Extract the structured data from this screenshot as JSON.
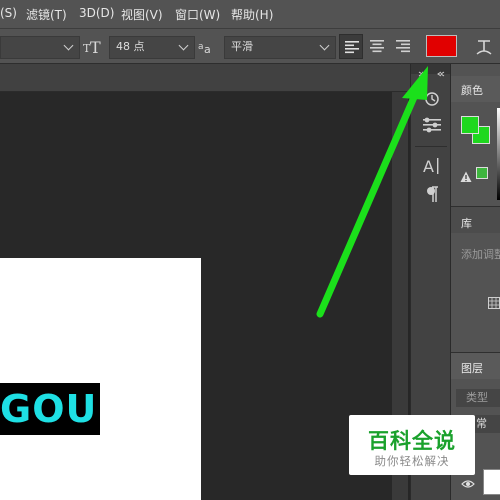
{
  "menubar": {
    "items": [
      {
        "label": "(S)"
      },
      {
        "label": "滤镜(T)"
      },
      {
        "label": "3D(D)"
      },
      {
        "label": "视图(V)"
      },
      {
        "label": "窗口(W)"
      },
      {
        "label": "帮助(H)"
      }
    ]
  },
  "options": {
    "font_size_value": "48 点",
    "antialias_value": "平滑",
    "text_color": "#e10000"
  },
  "canvas": {
    "logo_text": "GOU",
    "logo_color": "#1ee0e4"
  },
  "right_panels": {
    "color_tab": "颜色",
    "library_tab": "库",
    "library_hint": "添加调整",
    "layers_tab": "图层",
    "layers_search": "类型",
    "blend_mode": "常"
  },
  "annotation": {
    "arrow_color": "#1be01b"
  },
  "watermark": {
    "title": "百科全说",
    "subtitle": "助你轻松解决"
  }
}
